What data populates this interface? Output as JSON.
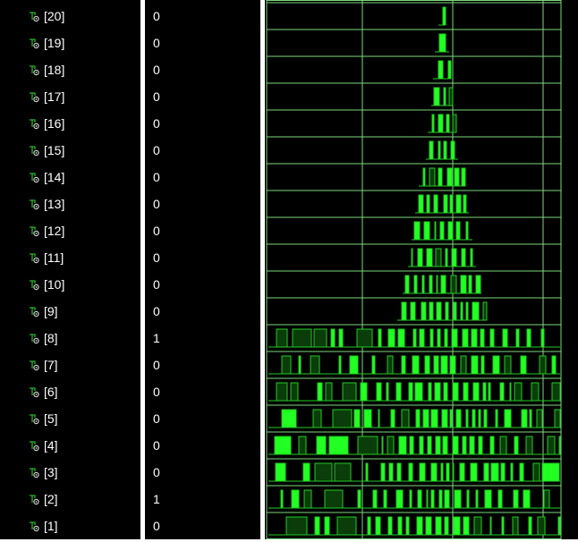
{
  "signals": [
    {
      "name": "[20]",
      "value": "0"
    },
    {
      "name": "[19]",
      "value": "0"
    },
    {
      "name": "[18]",
      "value": "0"
    },
    {
      "name": "[17]",
      "value": "0"
    },
    {
      "name": "[16]",
      "value": "0"
    },
    {
      "name": "[15]",
      "value": "0"
    },
    {
      "name": "[14]",
      "value": "0"
    },
    {
      "name": "[13]",
      "value": "0"
    },
    {
      "name": "[12]",
      "value": "0"
    },
    {
      "name": "[11]",
      "value": "0"
    },
    {
      "name": "[10]",
      "value": "0"
    },
    {
      "name": "[9]",
      "value": "0"
    },
    {
      "name": "[8]",
      "value": "1"
    },
    {
      "name": "[7]",
      "value": "0"
    },
    {
      "name": "[6]",
      "value": "0"
    },
    {
      "name": "[5]",
      "value": "0"
    },
    {
      "name": "[4]",
      "value": "0"
    },
    {
      "name": "[3]",
      "value": "0"
    },
    {
      "name": "[2]",
      "value": "1"
    },
    {
      "name": "[1]",
      "value": "0"
    }
  ],
  "colors": {
    "background": "#000000",
    "text": "#ffffff",
    "grid": "#7dd87d",
    "wave_line": "#22cc22",
    "wave_fill": "#0a3d0a",
    "wave_fill_bright": "#22ff22",
    "icon": "#29b329"
  },
  "icons": {
    "signal": "wire-signal-icon"
  }
}
